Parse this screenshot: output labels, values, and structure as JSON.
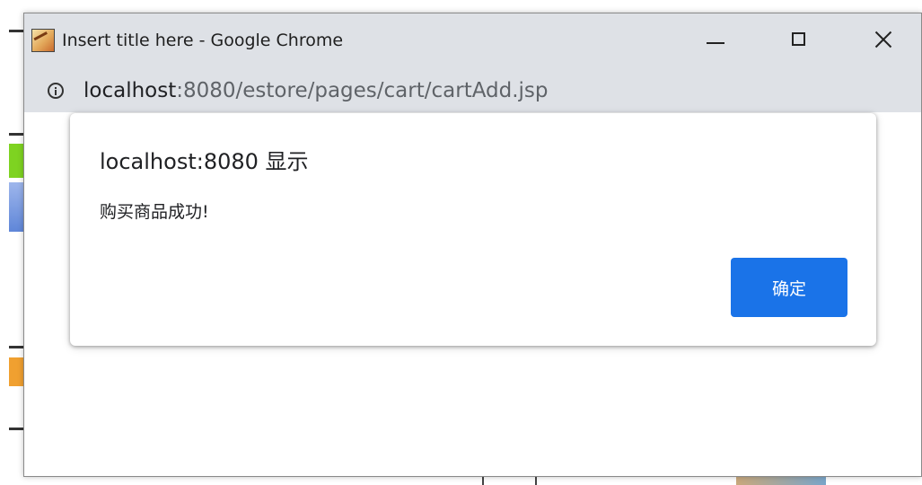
{
  "window": {
    "title": "Insert title here - Google Chrome",
    "icon": "tomcat-app-icon",
    "controls": {
      "minimize": "minimize-icon",
      "maximize": "maximize-icon",
      "close": "close-icon"
    }
  },
  "address_bar": {
    "icon": "info-icon",
    "host": "localhost",
    "path": ":8080/estore/pages/cart/cartAdd.jsp"
  },
  "dialog": {
    "title": "localhost:8080 显示",
    "message": "购买商品成功!",
    "ok_label": "确定"
  },
  "colors": {
    "chrome_frame": "#dee1e6",
    "primary_button": "#1a73e8",
    "text": "#202124",
    "url_path": "#5f6368"
  }
}
